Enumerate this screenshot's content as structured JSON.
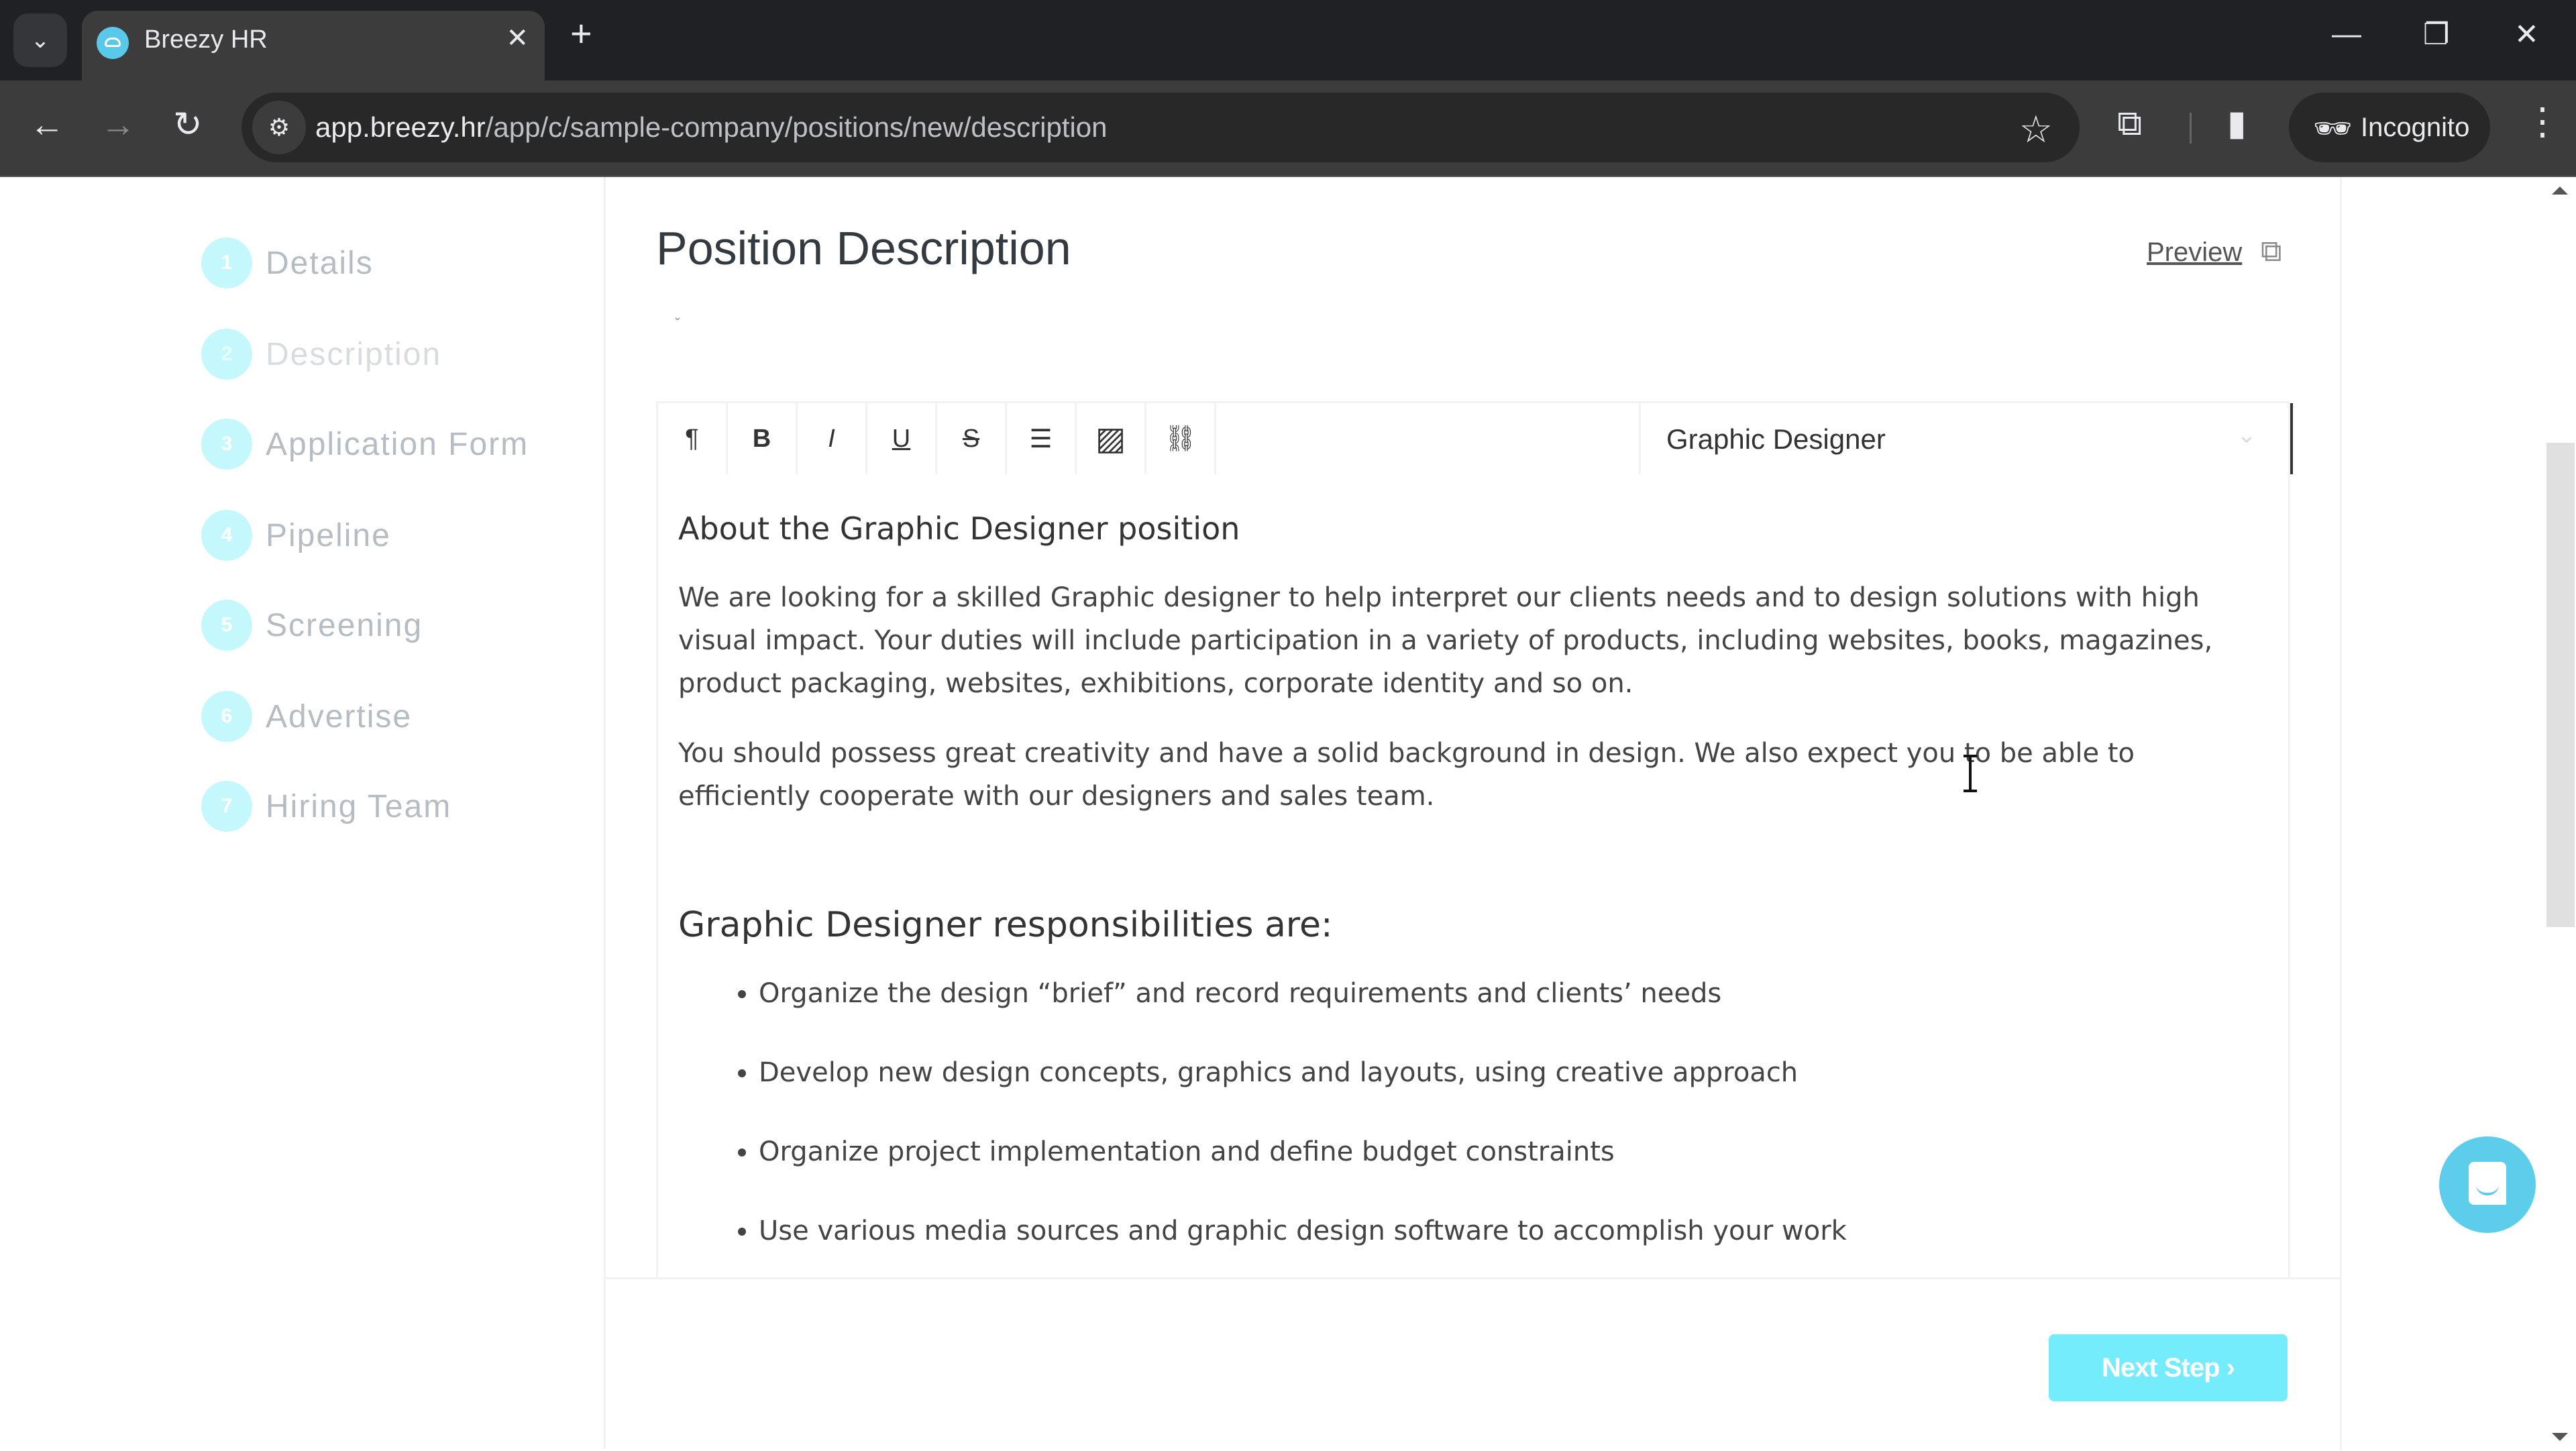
{
  "browser": {
    "tab_title": "Breezy HR",
    "url_host": "app.breezy.hr",
    "url_path": "/app/c/sample-company/positions/new/description",
    "incognito_label": "Incognito",
    "icons": {
      "tab_search": "chevron-down-icon",
      "favicon": "breezy-cloud-icon",
      "close_tab": "close-icon",
      "new_tab": "plus-icon",
      "back": "arrow-left-icon",
      "forward": "arrow-right-icon",
      "reload": "reload-icon",
      "site_info": "tune-icon",
      "bookmark": "star-icon",
      "extensions": "puzzle-icon",
      "side_panel": "side-panel-icon",
      "incognito": "incognito-icon",
      "menu": "kebab-menu-icon",
      "minimize": "minimize-icon",
      "restore": "restore-icon",
      "close_window": "close-icon"
    },
    "glyphs": {
      "tab_search": "⌄",
      "close_tab": "✕",
      "new_tab": "+",
      "back": "←",
      "forward": "→",
      "reload": "↻",
      "site_info": "⚙",
      "bookmark": "☆",
      "extensions": "⧉",
      "side_panel": "▮",
      "incognito": "🕶",
      "menu": "⋮",
      "minimize": "—",
      "restore": "❐",
      "close_window": "✕"
    }
  },
  "sidebar": {
    "steps": [
      {
        "number": "1",
        "label": "Details"
      },
      {
        "number": "2",
        "label": "Description"
      },
      {
        "number": "3",
        "label": "Application Form"
      },
      {
        "number": "4",
        "label": "Pipeline"
      },
      {
        "number": "5",
        "label": "Screening"
      },
      {
        "number": "6",
        "label": "Advertise"
      },
      {
        "number": "7",
        "label": "Hiring Team"
      }
    ],
    "active_step": "Description"
  },
  "main": {
    "title": "Position Description",
    "preview_label": "Preview",
    "preview_icon": "external-link-icon",
    "preview_glyph": "⧉",
    "stray_mark": "ˇ"
  },
  "editor": {
    "toolbar": [
      {
        "name": "paragraph",
        "icon": "paragraph-icon",
        "glyph": "¶"
      },
      {
        "name": "bold",
        "icon": "bold-icon",
        "glyph": "B"
      },
      {
        "name": "italic",
        "icon": "italic-icon",
        "glyph": "I"
      },
      {
        "name": "underline",
        "icon": "underline-icon",
        "glyph": "U"
      },
      {
        "name": "strikethrough",
        "icon": "strikethrough-icon",
        "glyph": "S"
      },
      {
        "name": "bullet-list",
        "icon": "list-icon",
        "glyph": "☰"
      },
      {
        "name": "image",
        "icon": "image-icon",
        "glyph": "▨"
      },
      {
        "name": "link",
        "icon": "link-icon",
        "glyph": "⛓"
      }
    ],
    "template_select": {
      "value": "Graphic Designer",
      "chevron": "⌄"
    },
    "content": {
      "heading": "About the Graphic Designer position",
      "paragraphs": [
        "We are looking for a skilled Graphic designer to help interpret our clients needs and to design solutions with high visual impact. Your duties will include participation in a variety of products, including websites, books, magazines, product packaging, websites, exhibitions, corporate identity and so on.",
        "You should possess great creativity and have a solid background in design. We also expect you to be able to efficiently cooperate with our designers and sales team."
      ],
      "responsibilities_heading": "Graphic Designer responsibilities are:",
      "responsibilities": [
        "Organize the design “brief” and record requirements and clients’ needs",
        "Develop new design concepts, graphics and layouts, using creative approach",
        "Organize project implementation and define budget constraints",
        "Use various media sources and graphic design software to accomplish your work"
      ]
    }
  },
  "footer": {
    "next_step_label": "Next Step ›"
  },
  "chat": {
    "icon": "chat-bubble-icon"
  },
  "colors": {
    "accent": "#74ecfc",
    "step_circle": "#c5f8fc",
    "chat": "#5ccdea",
    "chrome_dark": "#202124",
    "chrome_toolbar": "#3c3c3c"
  }
}
